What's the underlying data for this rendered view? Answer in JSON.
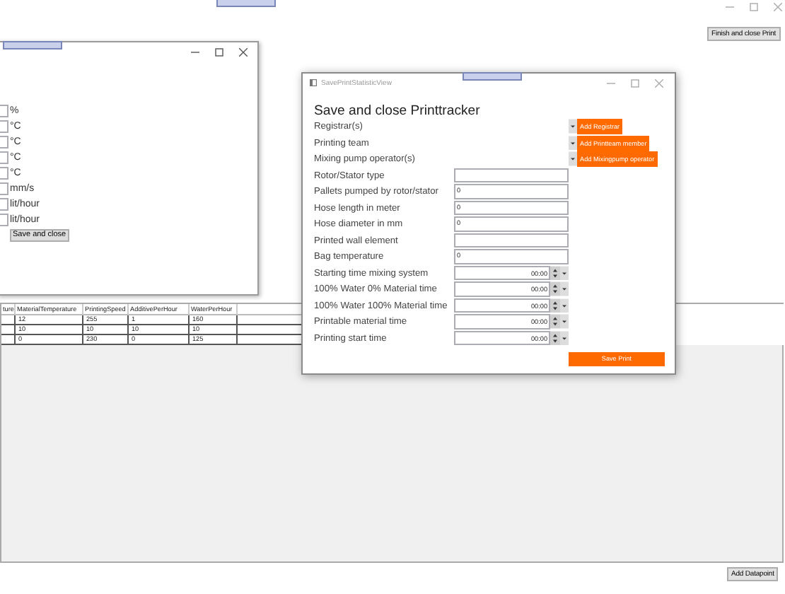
{
  "main_window": {
    "finish_button": "Finish and close Print",
    "add_datapoint_button": "Add Datapoint"
  },
  "settings_window": {
    "units": [
      "%",
      "°C",
      "°C",
      "°C",
      "°C",
      "mm/s",
      "lit/hour",
      "lit/hour"
    ],
    "save_button": "Save and close"
  },
  "data_grid": {
    "columns": [
      "ture",
      "MaterialTemperature",
      "PrintingSpeed",
      "AdditivePerHour",
      "WaterPerHour"
    ],
    "rows": [
      {
        "cells": [
          "",
          "12",
          "255",
          "1",
          "160"
        ]
      },
      {
        "cells": [
          "",
          "10",
          "10",
          "10",
          "10"
        ]
      },
      {
        "cells": [
          "",
          "0",
          "230",
          "0",
          "125"
        ]
      }
    ]
  },
  "dialog": {
    "title": "SavePrintStatisticView",
    "heading": "Save and close Printtracker",
    "fields": [
      {
        "label": "Registrar(s)",
        "kind": "picker",
        "button": "Add Registrar"
      },
      {
        "label": "Printing team",
        "kind": "picker",
        "button": "Add Printteam member"
      },
      {
        "label": "Mixing pump operator(s)",
        "kind": "picker",
        "button": "Add Mixingpump operator"
      },
      {
        "label": "Rotor/Stator type",
        "kind": "text"
      },
      {
        "label": "Pallets pumped by rotor/stator",
        "kind": "text",
        "value": "0"
      },
      {
        "label": "Hose length in meter",
        "kind": "text",
        "value": "0"
      },
      {
        "label": "Hose diameter in mm",
        "kind": "text",
        "value": "0"
      },
      {
        "label": "Printed wall element",
        "kind": "text"
      },
      {
        "label": "Bag temperature",
        "kind": "text",
        "value": "0"
      },
      {
        "label": "Starting time mixing system",
        "kind": "time",
        "value": "00:00"
      },
      {
        "label": "100% Water 0% Material time",
        "kind": "time",
        "value": "00:00"
      },
      {
        "label": "100% Water 100% Material time",
        "kind": "time",
        "value": "00:00"
      },
      {
        "label": "Printable material time",
        "kind": "time",
        "value": "00:00"
      },
      {
        "label": "Printing start time",
        "kind": "time",
        "value": "00:00"
      }
    ],
    "save_button": "Save Print"
  }
}
